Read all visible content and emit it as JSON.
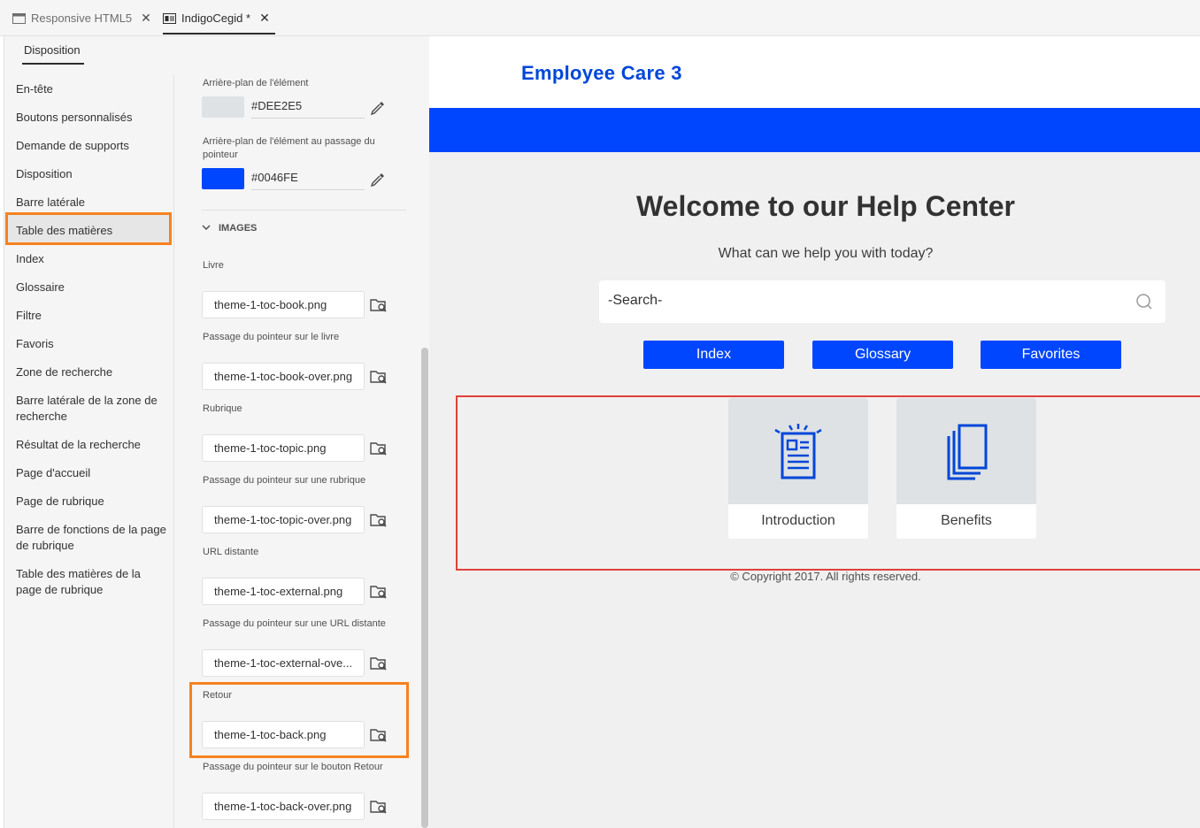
{
  "tabs": [
    {
      "label": "Responsive HTML5",
      "close": "✕",
      "active": false
    },
    {
      "label": "IndigoCegid *",
      "close": "✕",
      "active": true
    }
  ],
  "left_tab": "Disposition",
  "nav_items": [
    "En-tête",
    "Boutons personnalisés",
    "Demande de supports",
    "Disposition",
    "Barre latérale",
    "Table des matières",
    "Index",
    "Glossaire",
    "Filtre",
    "Favoris",
    "Zone de recherche",
    "Barre latérale de la zone de recherche",
    "Résultat de la recherche",
    "Page d'accueil",
    "Page de rubrique",
    "Barre de fonctions de la page de rubrique",
    "Table des matières de la page de rubrique"
  ],
  "selected_nav": "Table des matières",
  "properties": {
    "bg_label": "Arrière-plan de l'élément",
    "bg_value": "#DEE2E5",
    "bg_color": "#DEE2E5",
    "hover_label": "Arrière-plan de l'élément au passage du pointeur",
    "hover_value": "#0046FE",
    "hover_color": "#0046FE",
    "images_header": "IMAGES",
    "images": [
      {
        "label": "Livre",
        "file": "theme-1-toc-book.png"
      },
      {
        "label": "Passage du pointeur sur le livre",
        "file": "theme-1-toc-book-over.png"
      },
      {
        "label": "Rubrique",
        "file": "theme-1-toc-topic.png"
      },
      {
        "label": "Passage du pointeur sur une rubrique",
        "file": "theme-1-toc-topic-over.png"
      },
      {
        "label": "URL distante",
        "file": "theme-1-toc-external.png"
      },
      {
        "label": "Passage du pointeur sur une URL distante",
        "file": "theme-1-toc-external-ove..."
      },
      {
        "label": "Retour",
        "file": "theme-1-toc-back.png"
      },
      {
        "label": "Passage du pointeur sur le bouton Retour",
        "file": "theme-1-toc-back-over.png"
      }
    ]
  },
  "preview": {
    "site_title": "Employee Care 3",
    "welcome": "Welcome to our Help Center",
    "subtitle": "What can we help you with today?",
    "search_placeholder": "-Search-",
    "buttons": [
      "Index",
      "Glossary",
      "Favorites"
    ],
    "tiles": [
      {
        "label": "Introduction",
        "icon": "document-list-icon"
      },
      {
        "label": "Benefits",
        "icon": "stacked-pages-icon"
      }
    ],
    "copyright": "© Copyright 2017. All rights reserved.",
    "accent": "#0046FE"
  }
}
